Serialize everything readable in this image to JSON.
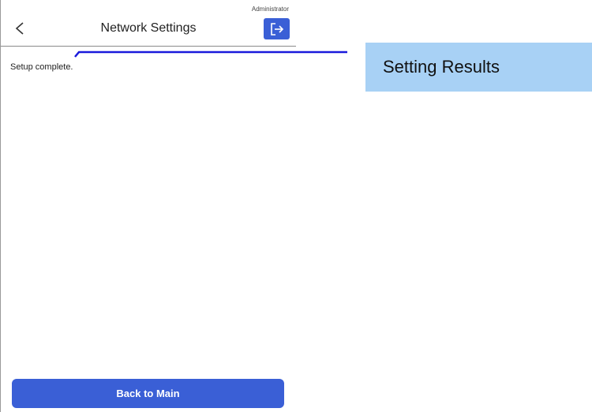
{
  "screen": {
    "user_role": "Administrator",
    "header": {
      "title": "Network Settings",
      "back_icon": "chevron-left-icon",
      "logout_icon": "logout-icon"
    },
    "status_message": "Setup complete.",
    "primary_button_label": "Back to Main"
  },
  "callout": {
    "label": "Setting Results"
  },
  "colors": {
    "accent": "#3a5fd6",
    "callout_bg": "#a8d1f5",
    "callout_line": "#1a1adb"
  }
}
